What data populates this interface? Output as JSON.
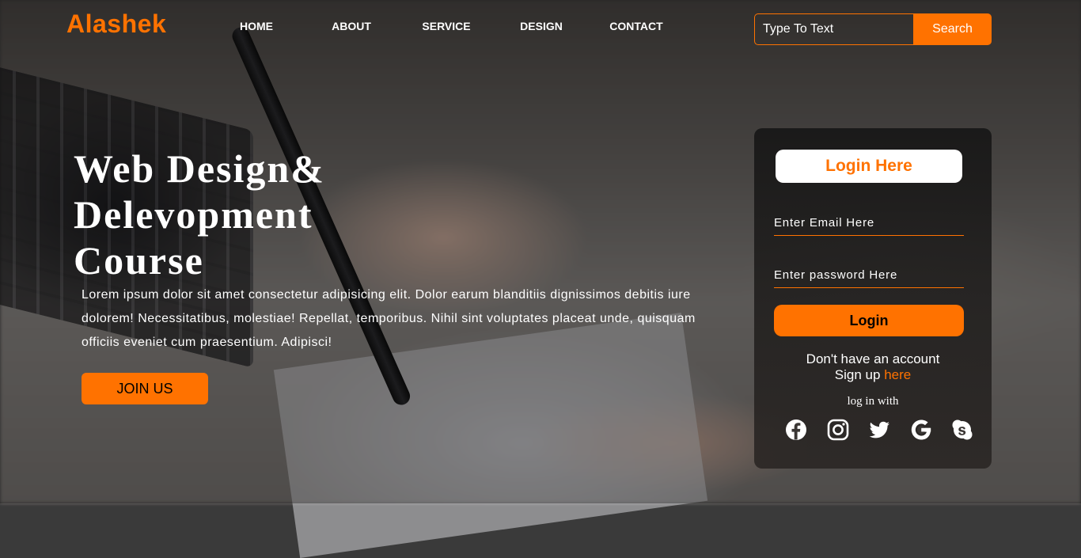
{
  "header": {
    "logo": "Alashek",
    "nav": [
      "HOME",
      "ABOUT",
      "SERVICE",
      "DESIGN",
      "CONTACT"
    ],
    "search": {
      "placeholder": "Type To Text",
      "button_label": "Search"
    }
  },
  "hero": {
    "title": "Web Design& Delevopment Course",
    "text": "Lorem ipsum dolor sit amet consectetur adipisicing elit. Dolor earum blanditiis dignissimos debitis iure dolorem! Necessitatibus, molestiae! Repellat, temporibus. Nihil sint voluptates placeat unde, quisquam officiis eveniet cum praesentium. Adipisci!",
    "button_label": "JOIN US"
  },
  "login": {
    "heading": "Login Here",
    "email_placeholder": "Enter Email Here",
    "password_placeholder": "Enter password Here",
    "button_label": "Login",
    "signup_line1": "Don't have an account",
    "signup_prefix": "Sign up",
    "signup_link": "here",
    "login_with": "log in with",
    "social_icons": [
      "facebook-icon",
      "instagram-icon",
      "twitter-icon",
      "google-icon",
      "skype-icon"
    ]
  },
  "colors": {
    "accent": "#ff7200",
    "text": "#ffffff"
  }
}
